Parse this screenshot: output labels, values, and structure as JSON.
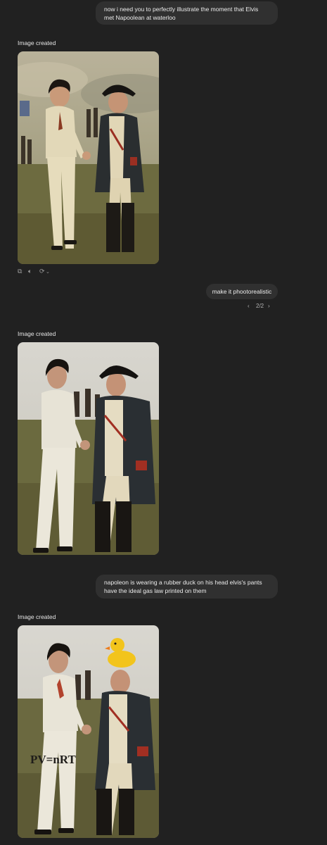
{
  "messages": {
    "m1": "now i need you to perfectly illustrate the moment that Elvis met Napoolean at waterloo",
    "m2": "make it phootorealistic",
    "m3": "napoleon is wearing a rubber duck on his head elvis's pants have the ideal gas law printed on them"
  },
  "image_label": "Image created",
  "pager": {
    "prev": "‹",
    "current": "2/2",
    "next": "›"
  },
  "pants_text": "PV=nRT",
  "icons": [
    "copy-icon",
    "speaker-icon",
    "regenerate-icon",
    "chevron-down-icon"
  ],
  "colors": {
    "background": "#212121",
    "bubble": "#303030",
    "text": "#ececec"
  }
}
